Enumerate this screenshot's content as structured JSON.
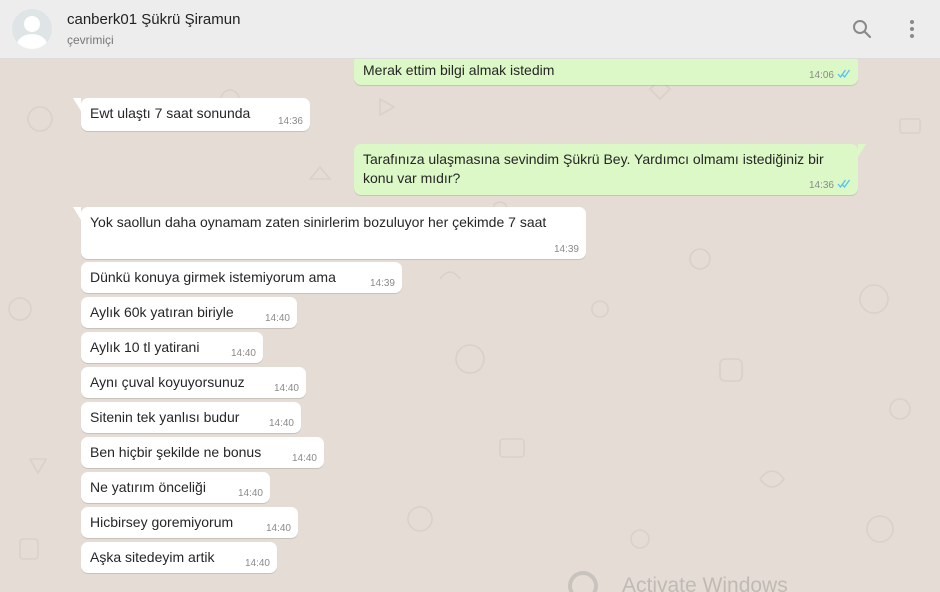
{
  "header": {
    "contact_name": "canberk01 Şükrü Şiramun",
    "contact_status": "çevrimiçi",
    "icons": [
      "search-icon",
      "menu-icon"
    ]
  },
  "colors": {
    "incoming_bubble": "#ffffff",
    "outgoing_bubble": "#dcf8c6",
    "read_ticks": "#4fc3f7",
    "chat_background": "#e5ddd5",
    "header_background": "#ededed"
  },
  "messages": [
    {
      "direction": "out",
      "text": "Merak ettim bilgi almak istedim",
      "time": "14:06",
      "read": true
    },
    {
      "direction": "in",
      "text": "Ewt ulaştı 7 saat sonunda",
      "time": "14:36"
    },
    {
      "direction": "out",
      "text": "Tarafınıza ulaşmasına sevindim Şükrü Bey. Yardımcı olmamı istediğiniz bir konu var mıdır?",
      "time": "14:36",
      "read": true
    },
    {
      "direction": "in",
      "text": "Yok saollun daha oynamam zaten sinirlerim bozuluyor her çekimde 7 saat",
      "time": "14:39"
    },
    {
      "direction": "in",
      "text": "Dünkü konuya girmek istemiyorum ama",
      "time": "14:39"
    },
    {
      "direction": "in",
      "text": "Aylık 60k yatıran biriyle",
      "time": "14:40"
    },
    {
      "direction": "in",
      "text": "Aylık 10 tl yatirani",
      "time": "14:40"
    },
    {
      "direction": "in",
      "text": "Aynı çuval koyuyorsunuz",
      "time": "14:40"
    },
    {
      "direction": "in",
      "text": "Sitenin tek yanlısı budur",
      "time": "14:40"
    },
    {
      "direction": "in",
      "text": "Ben hiçbir şekilde ne bonus",
      "time": "14:40"
    },
    {
      "direction": "in",
      "text": "Ne yatırım önceliği",
      "time": "14:40"
    },
    {
      "direction": "in",
      "text": "Hicbirsey goremiyorum",
      "time": "14:40"
    },
    {
      "direction": "in",
      "text": "Aşka sitedeyim artik",
      "time": "14:40"
    }
  ],
  "watermark": {
    "text": "Activate Windows"
  }
}
